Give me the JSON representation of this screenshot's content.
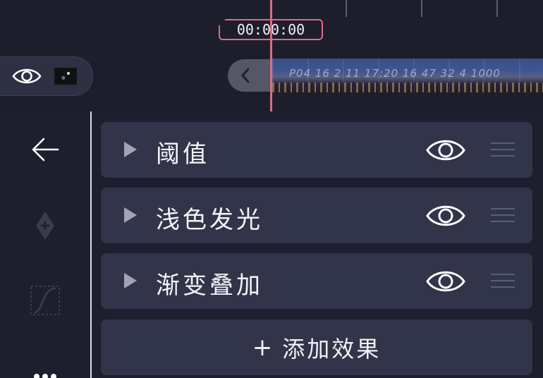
{
  "timeline": {
    "timecode": "00:00:00",
    "clip_caption": "P04 16 2 11 17:20 16 47 32 4 1000"
  },
  "layer": {
    "visibility_icon": "eye-icon",
    "thumbnail": "video-thumbnail"
  },
  "sidebar": {
    "back_icon": "arrow-left-icon",
    "keyframe_icon": "keyframe-diamond-plus-icon",
    "curve_icon": "bezier-curve-icon",
    "more_icon": "more-dots-icon"
  },
  "effects": [
    {
      "label": "阈值",
      "expand_icon": "triangle-right-icon",
      "visibility_icon": "eye-icon",
      "handle_icon": "drag-handle-icon"
    },
    {
      "label": "浅色发光",
      "expand_icon": "triangle-right-icon",
      "visibility_icon": "eye-icon",
      "handle_icon": "drag-handle-icon"
    },
    {
      "label": "渐变叠加",
      "expand_icon": "triangle-right-icon",
      "visibility_icon": "eye-icon",
      "handle_icon": "drag-handle-icon"
    }
  ],
  "add_effect": {
    "plus": "+",
    "label": "添加效果"
  },
  "colors": {
    "background": "#1e1f2e",
    "panel": "#323449",
    "accent": "#e06a87",
    "icon_muted": "#a2a3b4"
  }
}
